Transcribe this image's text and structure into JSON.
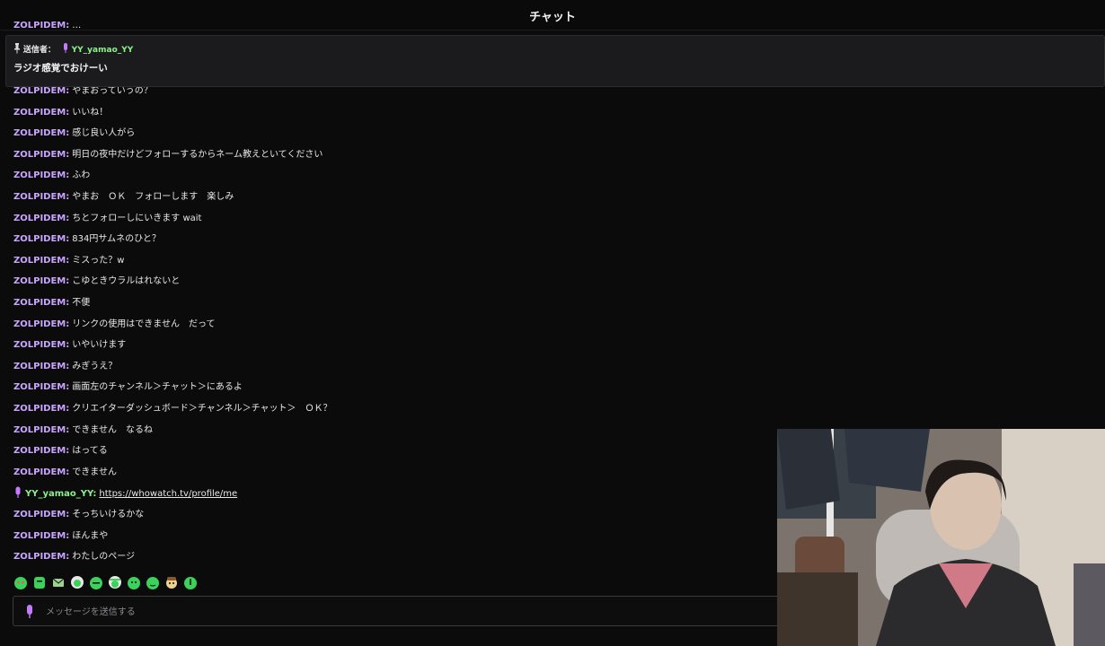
{
  "header": {
    "title": "チャット"
  },
  "pinned": {
    "sender_label": "送信者：",
    "sender_name": "YY_yamao_YY",
    "message": "ラジオ感覚でおけーい"
  },
  "messages": [
    {
      "author": "ZOLPIDEM",
      "text": "やまおっていうの？"
    },
    {
      "author": "ZOLPIDEM",
      "text": "いいね！"
    },
    {
      "author": "ZOLPIDEM",
      "text": "感じ良い人がら"
    },
    {
      "author": "ZOLPIDEM",
      "text": "明日の夜中だけどフォローするからネーム教えといてください"
    },
    {
      "author": "ZOLPIDEM",
      "text": "ふわ"
    },
    {
      "author": "ZOLPIDEM",
      "text": "やまお　ＯＫ　フォローします　楽しみ"
    },
    {
      "author": "ZOLPIDEM",
      "text": "ちとフォローしにいきます wait"
    },
    {
      "author": "ZOLPIDEM",
      "text": "834円サムネのひと？"
    },
    {
      "author": "ZOLPIDEM",
      "text": "ミスった？w"
    },
    {
      "author": "ZOLPIDEM",
      "text": "こゆときウラルはれないと"
    },
    {
      "author": "ZOLPIDEM",
      "text": "不便"
    },
    {
      "author": "ZOLPIDEM",
      "text": "リンクの使用はできません　だって"
    },
    {
      "author": "ZOLPIDEM",
      "text": "いやいけます"
    },
    {
      "author": "ZOLPIDEM",
      "text": "みぎうえ？"
    },
    {
      "author": "ZOLPIDEM",
      "text": "画面左のチャンネル＞チャット＞にあるよ"
    },
    {
      "author": "ZOLPIDEM",
      "text": "クリエイターダッシュボード＞チャンネル＞チャット＞　ＯＫ？"
    },
    {
      "author": "ZOLPIDEM",
      "text": "できません　なるね"
    },
    {
      "author": "ZOLPIDEM",
      "text": "はってる"
    },
    {
      "author": "ZOLPIDEM",
      "text": "できません"
    },
    {
      "author": "YY_yamao_YY",
      "text": "https://whowatch.tv/profile/me"
    },
    {
      "author": "ZOLPIDEM",
      "text": "そっちいけるかな"
    },
    {
      "author": "ZOLPIDEM",
      "text": "ほんまや"
    },
    {
      "author": "ZOLPIDEM",
      "text": "わたしのページ"
    }
  ],
  "input": {
    "placeholder": "メッセージを送信する"
  },
  "stamps": [
    "stamp-icon",
    "stamp-icon",
    "stamp-icon",
    "stamp-icon",
    "stamp-icon",
    "stamp-icon",
    "stamp-icon",
    "stamp-icon",
    "stamp-icon",
    "stamp-icon"
  ],
  "colors": {
    "author": "#c9a5ff",
    "broadcaster": "#8cf08a",
    "background": "#0b0b0c"
  }
}
